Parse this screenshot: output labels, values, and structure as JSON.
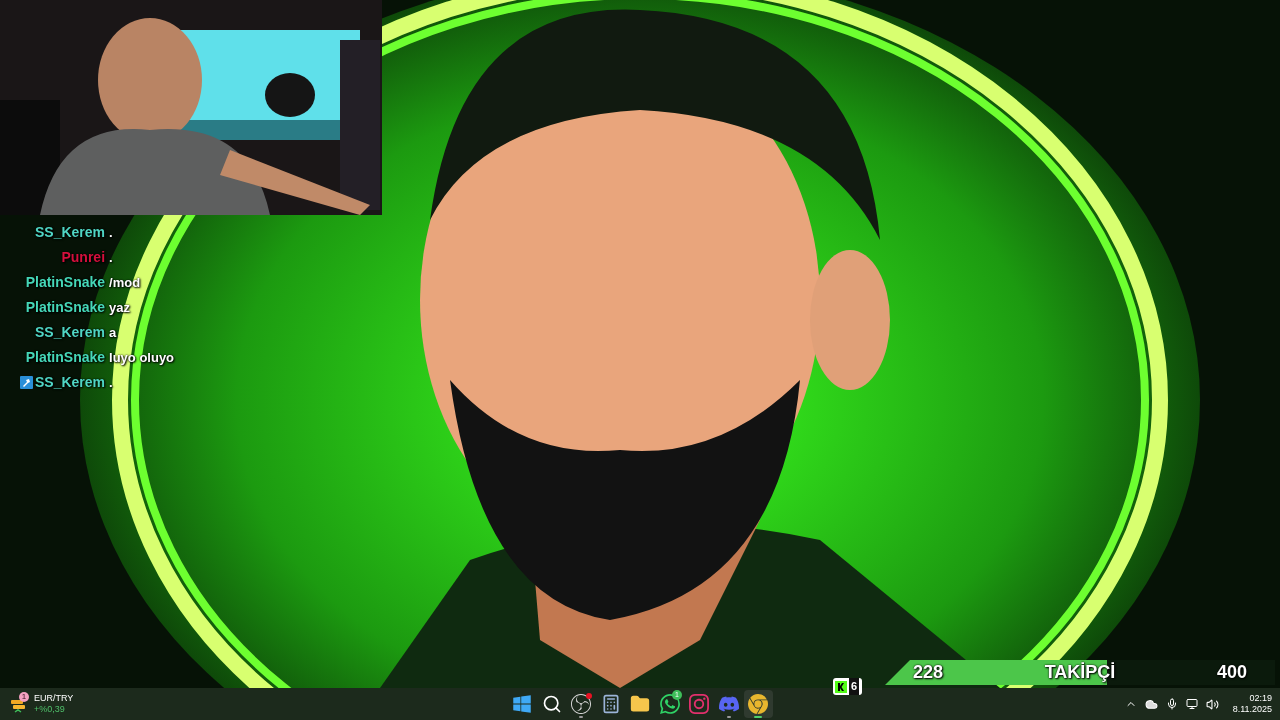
{
  "chat": {
    "messages": [
      {
        "user": "SS_Kerem",
        "color": "#4fd6c4",
        "text": ".",
        "badge": false
      },
      {
        "user": "Punrei",
        "color": "#d4103c",
        "text": ".",
        "badge": false
      },
      {
        "user": "PlatinSnake",
        "color": "#45d8b8",
        "text": "/mod",
        "badge": false
      },
      {
        "user": "PlatinSnake",
        "color": "#45d8b8",
        "text": "yaz",
        "badge": false
      },
      {
        "user": "SS_Kerem",
        "color": "#4fd6c4",
        "text": "a",
        "badge": false
      },
      {
        "user": "PlatinSnake",
        "color": "#45d8b8",
        "text": "luyo oluyo",
        "badge": false
      },
      {
        "user": "SS_Kerem",
        "color": "#4fd6c4",
        "text": ".",
        "badge": true
      }
    ]
  },
  "follower_goal": {
    "current": "228",
    "label": "TAKİPÇİ",
    "target": "400",
    "level": 0.57
  },
  "viewer_badge": {
    "count": "6"
  },
  "taskbar": {
    "widget": {
      "name": "EUR/TRY",
      "change": "+%0,39",
      "notification": "1"
    },
    "apps": [
      {
        "kind": "start",
        "running": false,
        "active": false,
        "alert": false
      },
      {
        "kind": "search",
        "running": false,
        "active": false,
        "alert": false
      },
      {
        "kind": "recorder",
        "running": true,
        "active": false,
        "alert": true
      },
      {
        "kind": "calculator",
        "running": false,
        "active": false,
        "alert": false
      },
      {
        "kind": "folder",
        "running": false,
        "active": false,
        "alert": false
      },
      {
        "kind": "messenger",
        "running": false,
        "active": false,
        "alert": false,
        "count": "1"
      },
      {
        "kind": "camera",
        "running": false,
        "active": false,
        "alert": false
      },
      {
        "kind": "chat",
        "running": true,
        "active": false,
        "alert": false
      },
      {
        "kind": "browser",
        "running": true,
        "active": true,
        "alert": false
      }
    ],
    "time": "02:19",
    "date": "8.11.2025"
  }
}
